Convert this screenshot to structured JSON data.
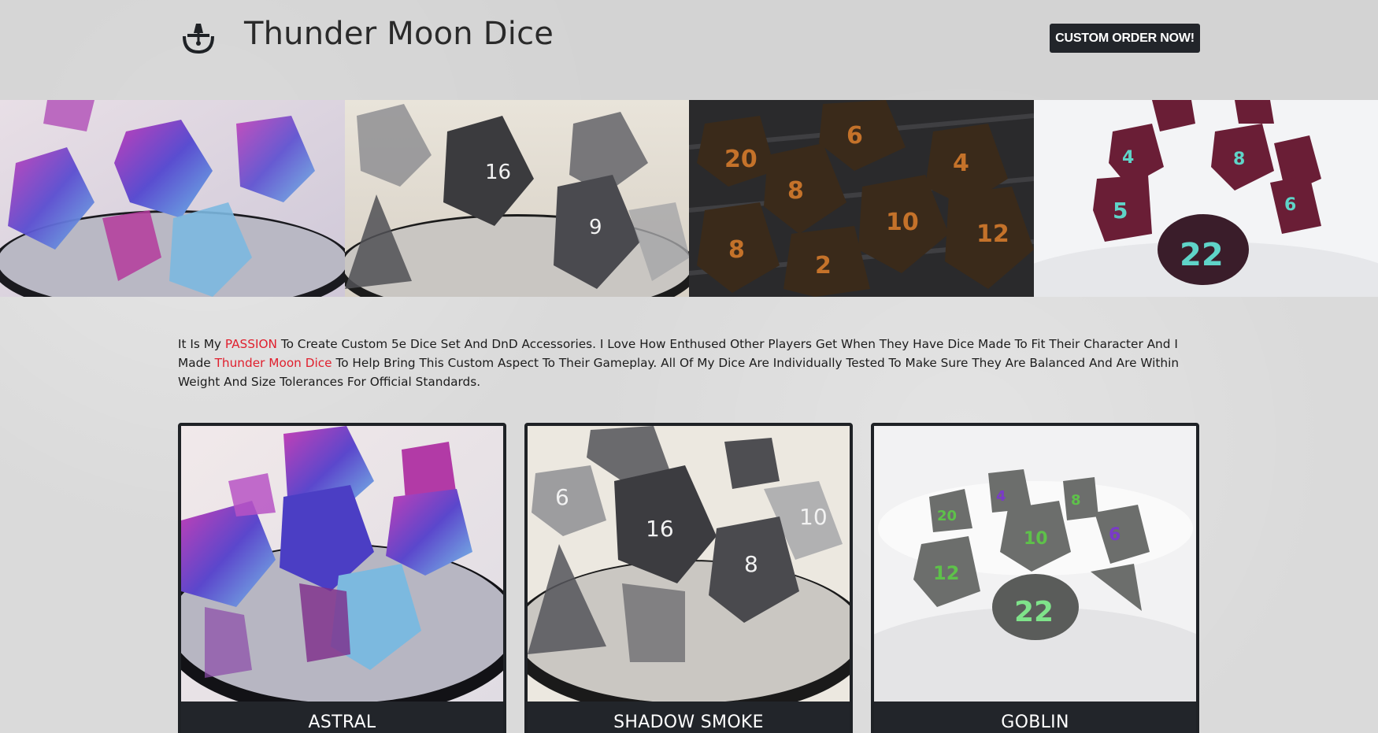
{
  "header": {
    "title": "Thunder Moon Dice",
    "logo_icon": "mortar-pestle-logo-icon",
    "cta_label": "CUSTOM ORDER NOW!"
  },
  "hero": {
    "images": [
      {
        "name": "astral-dice-photo",
        "accent": "#6a4bc4"
      },
      {
        "name": "shadow-smoke-dice-photo",
        "accent": "#3a3a3a"
      },
      {
        "name": "copper-fleck-dice-photo",
        "accent": "#c06a22"
      },
      {
        "name": "teal-crimson-dice-photo",
        "accent": "#b02050"
      }
    ]
  },
  "intro": {
    "p1": "It Is My ",
    "hl1": "PASSION",
    "p2": " To Create Custom 5e Dice Set And DnD Accessories. I Love How Enthused Other Players Get When They Have Dice Made To Fit Their Character And I Made ",
    "hl2": "Thunder Moon Dice",
    "p3": " To Help Bring This Custom Aspect To Their Gameplay. All Of My Dice Are Individually Tested To Make Sure They Are Balanced And Are Within Weight And Size Tolerances For Official Standards."
  },
  "products": [
    {
      "label": "ASTRAL"
    },
    {
      "label": "SHADOW SMOKE"
    },
    {
      "label": "GOBLIN"
    }
  ],
  "colors": {
    "highlight": "#e0202e",
    "dark": "#22252a",
    "background": "#dadada"
  }
}
